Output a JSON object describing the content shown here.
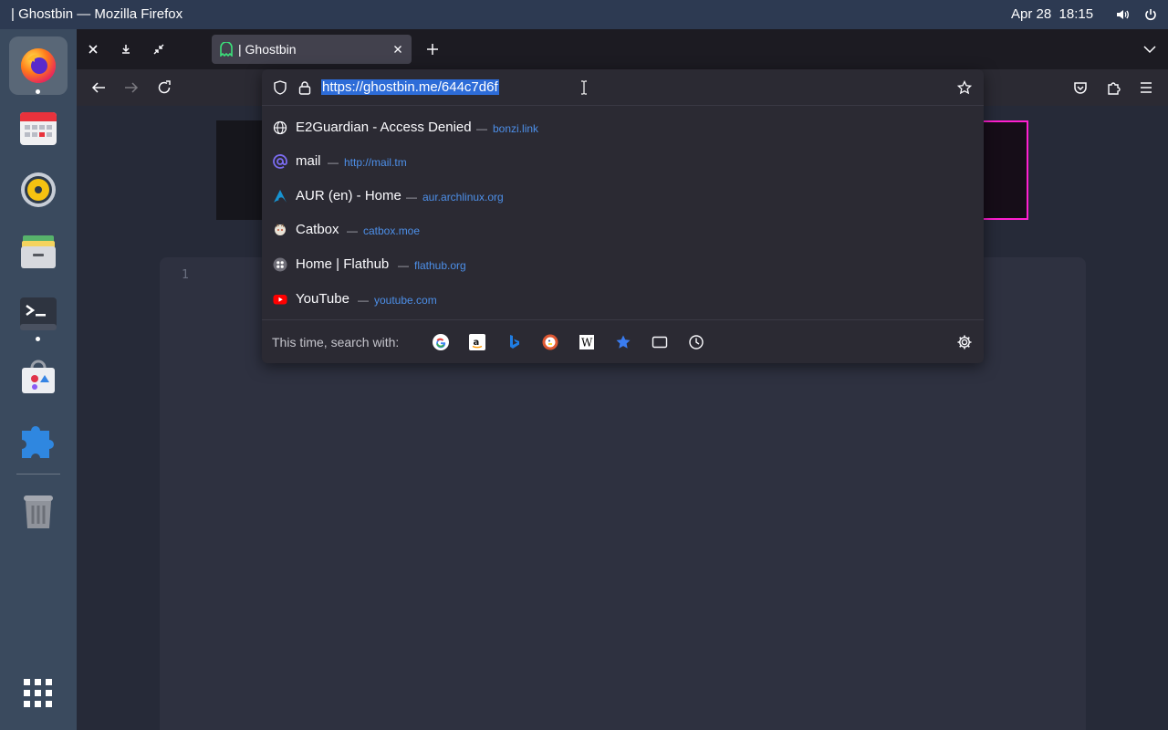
{
  "topbar": {
    "window_title": "| Ghostbin — Mozilla Firefox",
    "date": "Apr 28",
    "time": "18:15"
  },
  "dock": {
    "items": [
      "firefox-icon",
      "calendar-icon",
      "rhythmbox-icon",
      "files-icon",
      "terminal-icon",
      "software-icon",
      "extensions-icon",
      "trash-icon",
      "app-grid-icon"
    ]
  },
  "browser": {
    "tab": {
      "title": "| Ghostbin"
    },
    "url": "https://ghostbin.me/644c7d6f",
    "editor": {
      "line_number": "1"
    },
    "suggestions": [
      {
        "title": "E2Guardian - Access Denied",
        "url": "bonzi.link",
        "icon": "globe-icon"
      },
      {
        "title": "mail",
        "url": "http://mail.tm",
        "icon": "at-icon"
      },
      {
        "title": "AUR (en) - Home",
        "url": "aur.archlinux.org",
        "icon": "arch-icon"
      },
      {
        "title": "Catbox",
        "url": "catbox.moe",
        "icon": "catbox-icon"
      },
      {
        "title": "Home | Flathub",
        "url": "flathub.org",
        "icon": "flathub-icon"
      },
      {
        "title": "YouTube",
        "url": "youtube.com",
        "icon": "youtube-icon"
      }
    ],
    "search_with_label": "This time, search with:",
    "search_engines": [
      "google-icon",
      "amazon-icon",
      "bing-icon",
      "duckduckgo-icon",
      "wikipedia-icon",
      "bookmarks-icon",
      "tabs-icon",
      "history-icon"
    ],
    "colors": {
      "selection": "#2d6cd8",
      "link": "#4d8fe8",
      "banner_border": "#ff1fd0"
    }
  }
}
